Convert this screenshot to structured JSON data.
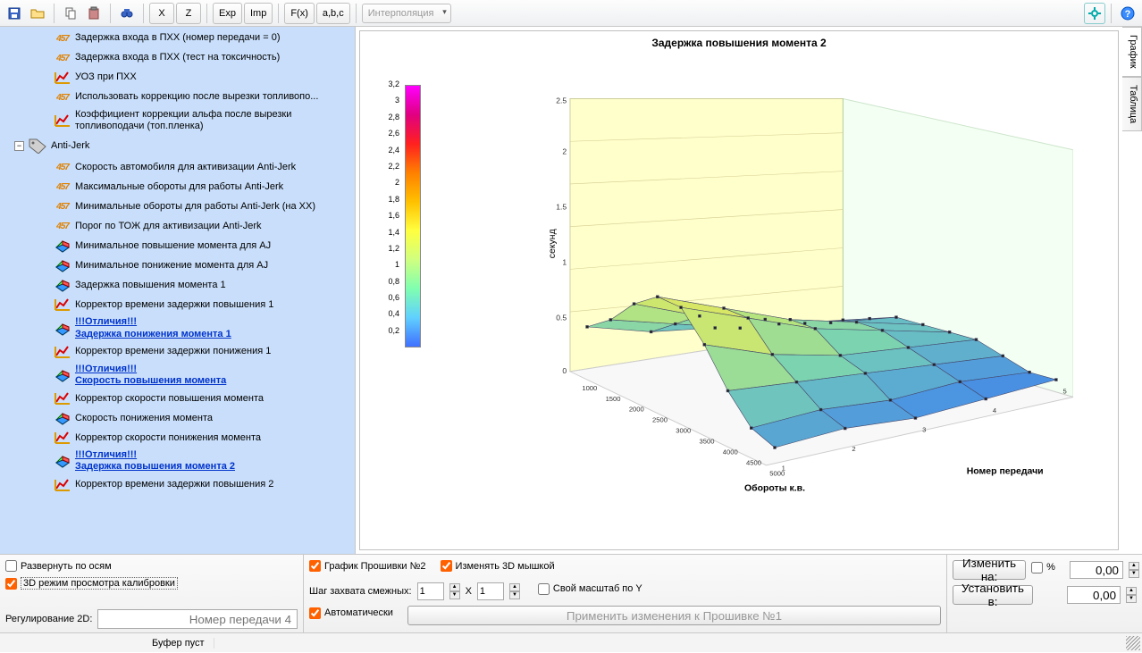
{
  "toolbar": {
    "btn_x": "X",
    "btn_z": "Z",
    "btn_exp": "Exp",
    "btn_imp": "Imp",
    "btn_fx": "F(x)",
    "btn_abc": "a,b,c",
    "interp_placeholder": "Интерполяция"
  },
  "tree": {
    "group_label": "Anti-Jerk",
    "items": [
      {
        "icon": "457",
        "label": "Задержка входа в ПХХ (номер передачи = 0)",
        "indent": 2
      },
      {
        "icon": "457",
        "label": "Задержка входа в ПХХ (тест на токсичность)",
        "indent": 2
      },
      {
        "icon": "chart",
        "label": "УОЗ при ПХХ",
        "indent": 2
      },
      {
        "icon": "457",
        "label": "Использовать коррекцию после вырезки топливопо...",
        "indent": 2
      },
      {
        "icon": "chart",
        "label": "Коэффициент коррекции альфа после вырезки топливоподачи (топ.пленка)",
        "indent": 2
      },
      {
        "icon": "457",
        "label": "Скорость автомобиля для активизации Anti-Jerk",
        "indent": 2
      },
      {
        "icon": "457",
        "label": "Максимальные обороты для работы Anti-Jerk",
        "indent": 2
      },
      {
        "icon": "457",
        "label": "Минимальные обороты для работы Anti-Jerk (на ХХ)",
        "indent": 2
      },
      {
        "icon": "457",
        "label": "Порог по ТОЖ для активизации Anti-Jerk",
        "indent": 2
      },
      {
        "icon": "3d",
        "label": "Минимальное повышение момента для AJ",
        "indent": 2
      },
      {
        "icon": "3d",
        "label": "Минимальное понижение момента для AJ",
        "indent": 2
      },
      {
        "icon": "3d",
        "label": "Задержка повышения момента 1",
        "indent": 2
      },
      {
        "icon": "chart",
        "label": "Корректор времени задержки повышения 1",
        "indent": 2
      },
      {
        "icon": "3d",
        "label": "!!!Отличия!!!\nЗадержка понижения момента 1",
        "indent": 2,
        "link": true
      },
      {
        "icon": "chart",
        "label": "Корректор времени задержки понижения 1",
        "indent": 2
      },
      {
        "icon": "3d",
        "label": "!!!Отличия!!!\nСкорость повышения момента",
        "indent": 2,
        "link": true
      },
      {
        "icon": "chart",
        "label": "Корректор скорости повышения момента",
        "indent": 2
      },
      {
        "icon": "3d",
        "label": "Скорость понижения момента",
        "indent": 2
      },
      {
        "icon": "chart",
        "label": "Корректор скорости понижения момента",
        "indent": 2
      },
      {
        "icon": "3d",
        "label": "!!!Отличия!!!\nЗадержка повышения момента 2",
        "indent": 2,
        "link": true
      },
      {
        "icon": "chart",
        "label": "Корректор времени задержки повышения 2",
        "indent": 2
      }
    ]
  },
  "chart": {
    "title": "Задержка повышения момента 2",
    "zlabel": "секунд",
    "xlabel": "Обороты к.в.",
    "ylabel": "Номер передачи",
    "tab_graph": "График",
    "tab_table": "Таблица"
  },
  "legend_ticks": [
    "3,2",
    "3",
    "2,8",
    "2,6",
    "2,4",
    "2,2",
    "2",
    "1,8",
    "1,6",
    "1,4",
    "1,2",
    "1",
    "0,8",
    "0,6",
    "0,4",
    "0,2"
  ],
  "bottom": {
    "expand_axes": "Развернуть по осям",
    "mode3d": "3D режим просмотра калибровки",
    "reg2d_label": "Регулирование 2D:",
    "reg2d_placeholder": "Номер передачи 4",
    "fw2": "График Прошивки №2",
    "mouse3d": "Изменять 3D мышкой",
    "step_label": "Шаг захвата смежных:",
    "step_x_val": "1",
    "step_y_val": "1",
    "x_sep": "X",
    "own_scale": "Свой масштаб по Y",
    "auto": "Автоматически",
    "apply_btn": "Применить изменения к Прошивке №1",
    "change_to": "Изменить на:",
    "percent": "%",
    "set_to": "Установить в:",
    "val1": "0,00",
    "val2": "0,00"
  },
  "status": {
    "buffer": "Буфер пуст"
  },
  "chart_data": {
    "type": "surface",
    "title": "Задержка повышения момента 2",
    "xlabel": "Обороты к.в.",
    "ylabel": "Номер передачи",
    "zlabel": "секунд",
    "x": [
      1000,
      1500,
      2000,
      2500,
      3000,
      3500,
      4000,
      4500,
      5000
    ],
    "y": [
      1,
      2,
      3,
      4,
      5
    ],
    "z": [
      [
        0.6,
        0.8,
        1.1,
        1.3,
        1.3,
        1.0,
        0.6,
        0.3,
        0.2
      ],
      [
        0.4,
        0.6,
        0.8,
        1.0,
        1.0,
        0.7,
        0.5,
        0.3,
        0.2
      ],
      [
        0.3,
        0.4,
        0.6,
        0.7,
        0.7,
        0.5,
        0.4,
        0.2,
        0.1
      ],
      [
        0.2,
        0.3,
        0.4,
        0.5,
        0.5,
        0.4,
        0.3,
        0.2,
        0.1
      ],
      [
        0.1,
        0.2,
        0.3,
        0.3,
        0.3,
        0.3,
        0.2,
        0.1,
        0.1
      ]
    ],
    "zlim": [
      0.2,
      3.2
    ],
    "colormap": "rainbow"
  }
}
